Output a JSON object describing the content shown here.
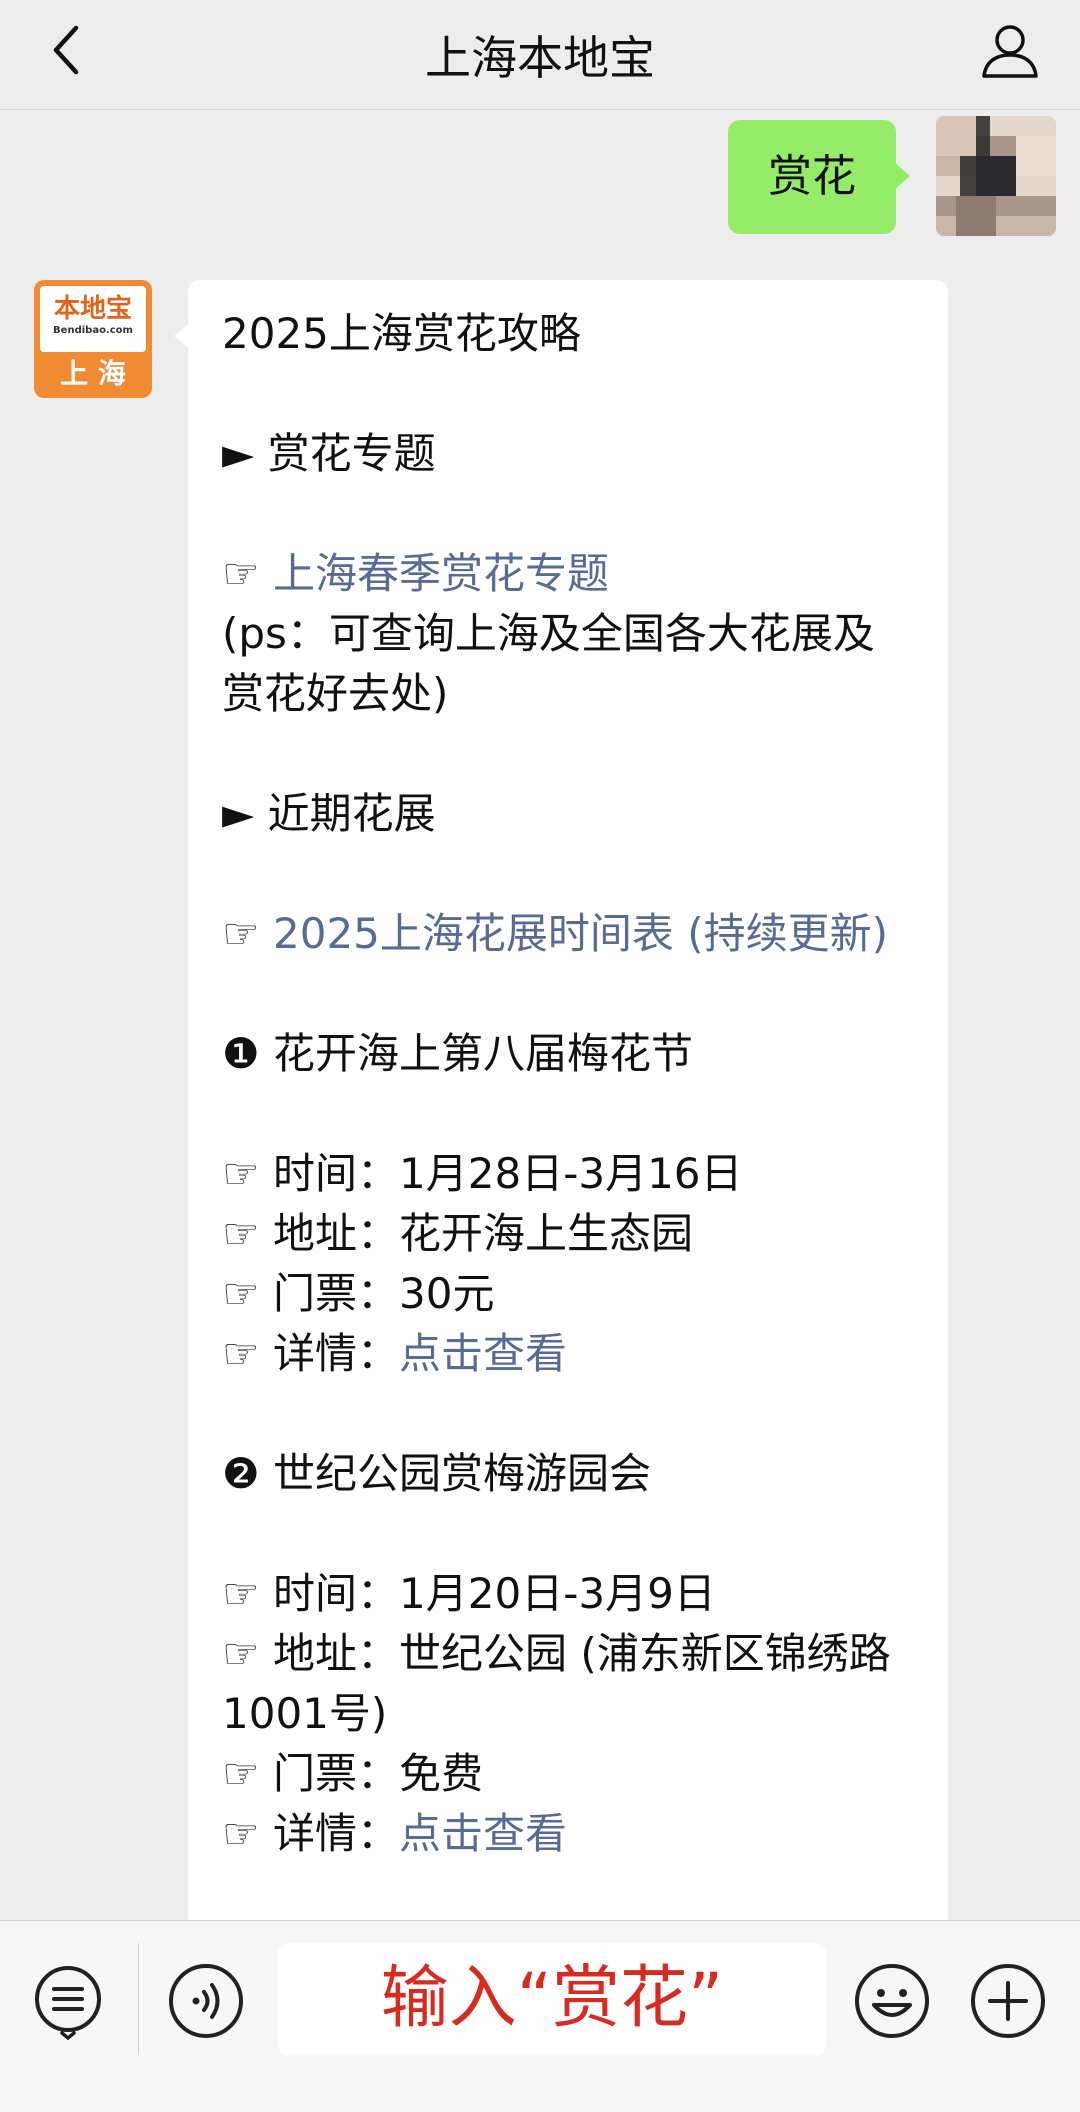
{
  "header": {
    "title": "上海本地宝"
  },
  "chat": {
    "user_message": "赏花",
    "bot_avatar": {
      "logo_name": "本地宝",
      "logo_url": "Bendibao.com",
      "city": "上 海"
    },
    "bot_message": {
      "title": "2025上海赏花攻略",
      "section1": "► 赏花专题",
      "topic_link": "上海春季赏花专题",
      "topic_note": "(ps：可查询上海及全国各大花展及赏花好去处)",
      "section2": "► 近期花展",
      "schedule_link": "2025上海花展时间表 (持续更新)",
      "events": [
        {
          "marker": "❶",
          "name": "花开海上第八届梅花节",
          "time_label": "时间：",
          "time": "1月28日-3月16日",
          "place_label": "地址：",
          "place": "花开海上生态园",
          "ticket_label": "门票：",
          "ticket": "30元",
          "detail_label": "详情：",
          "detail_link": "点击查看"
        },
        {
          "marker": "❷",
          "name": "世纪公园赏梅游园会",
          "time_label": "时间：",
          "time": "1月20日-3月9日",
          "place_label": "地址：",
          "place": "世纪公园 (浦东新区锦绣路1001号)",
          "ticket_label": "门票：",
          "ticket": "免费",
          "detail_label": "详情：",
          "detail_link": "点击查看"
        }
      ],
      "hand_glyph": "☞"
    }
  },
  "toolbar": {
    "input_text": "输入“赏花”"
  },
  "icons": {
    "back": "chevron-left-icon",
    "profile": "person-icon",
    "menu": "list-menu-icon",
    "voice": "voice-icon",
    "emoji": "smiley-icon",
    "plus": "plus-icon"
  }
}
